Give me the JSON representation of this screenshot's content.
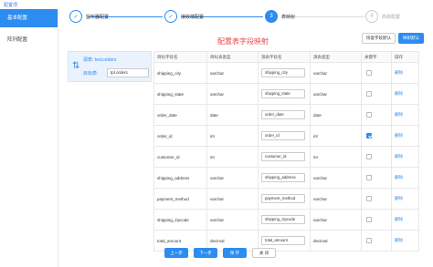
{
  "app": {
    "title": "配置项"
  },
  "sidebar": {
    "items": [
      {
        "label": "基本配置",
        "active": true
      },
      {
        "label": "阵列配置",
        "active": false
      }
    ]
  },
  "steps": [
    {
      "index": "✓",
      "label": "监听器配置",
      "state": "done"
    },
    {
      "index": "✓",
      "label": "接收端配置",
      "state": "done"
    },
    {
      "index": "3",
      "label": "表映射",
      "state": "current"
    },
    {
      "index": "4",
      "label": "高级配置",
      "state": "pending"
    }
  ],
  "main": {
    "heading": "配置表字段映射",
    "btn_refresh": "恢复字段默认",
    "btn_auto": "映射默认"
  },
  "source": {
    "source_label": "源表: test.orders",
    "target_label": "目标表:",
    "target_value": "tpl.orders"
  },
  "table": {
    "headers": [
      "目标字段名",
      "目标表类型",
      "源表字段名",
      "源表类型",
      "关键字",
      "操作"
    ],
    "delete_label": "删除",
    "rows": [
      {
        "target": "shipping_city",
        "ttype": "varchar",
        "source": "shipping_city",
        "stype": "varchar",
        "key": false
      },
      {
        "target": "shipping_state",
        "ttype": "varchar",
        "source": "shipping_state",
        "stype": "varchar",
        "key": false
      },
      {
        "target": "order_date",
        "ttype": "date",
        "source": "order_date",
        "stype": "date",
        "key": false
      },
      {
        "target": "order_id",
        "ttype": "int",
        "source": "order_id",
        "stype": "int",
        "key": true
      },
      {
        "target": "customer_id",
        "ttype": "int",
        "source": "customer_id",
        "stype": "int",
        "key": false
      },
      {
        "target": "shipping_address",
        "ttype": "varchar",
        "source": "shipping_address",
        "stype": "varchar",
        "key": false
      },
      {
        "target": "payment_method",
        "ttype": "varchar",
        "source": "payment_method",
        "stype": "varchar",
        "key": false
      },
      {
        "target": "shipping_zipcode",
        "ttype": "varchar",
        "source": "shipping_zipcode",
        "stype": "varchar",
        "key": false
      },
      {
        "target": "total_amount",
        "ttype": "decimal",
        "source": "total_amount",
        "stype": "decimal",
        "key": false
      }
    ]
  },
  "footer": {
    "prev": "上一步",
    "next": "下一步",
    "save": "保 存",
    "close": "关 闭"
  },
  "colors": {
    "accent": "#2d8cf0",
    "heading": "#e84a4a"
  }
}
